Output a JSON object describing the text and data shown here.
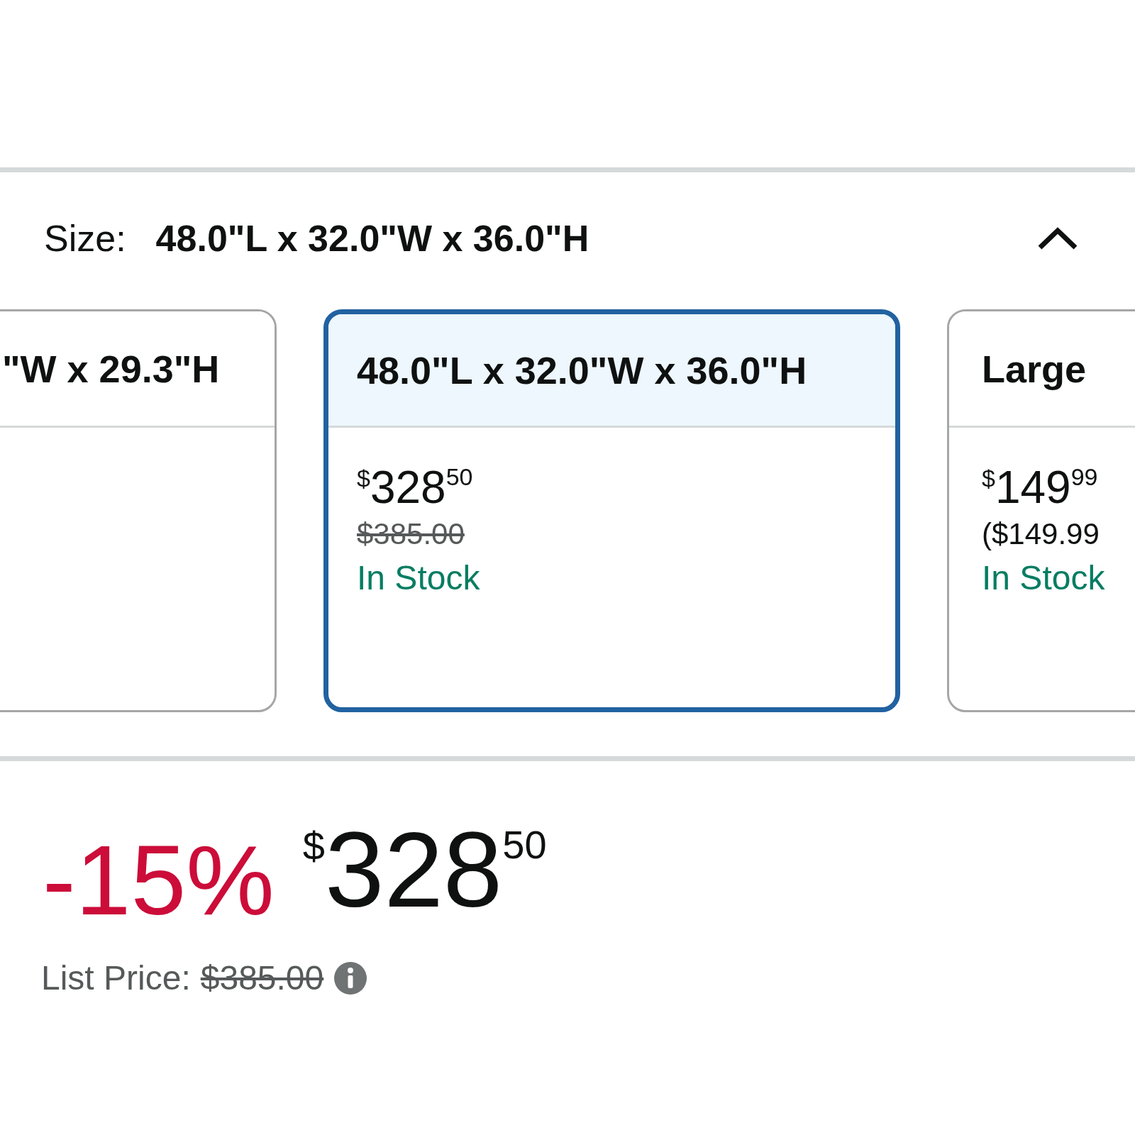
{
  "size_selector": {
    "label": "Size:",
    "value": "48.0\"L x 32.0\"W x 36.0\"H",
    "expanded": true
  },
  "options": [
    {
      "title": "\"W x 29.3\"H",
      "selected": false
    },
    {
      "title": "48.0\"L x 32.0\"W x 36.0\"H",
      "selected": true,
      "price": {
        "symbol": "$",
        "whole": "328",
        "fraction": "50"
      },
      "was_price": "$385.00",
      "availability": "In Stock"
    },
    {
      "title": "Large",
      "selected": false,
      "price": {
        "symbol": "$",
        "whole": "149",
        "fraction": "99"
      },
      "unit_price": "($149.99",
      "availability": "In Stock"
    }
  ],
  "deal": {
    "discount": "-15%",
    "price": {
      "symbol": "$",
      "whole": "328",
      "fraction": "50"
    },
    "list_price_label": "List Price:",
    "list_price": "$385.00"
  }
}
